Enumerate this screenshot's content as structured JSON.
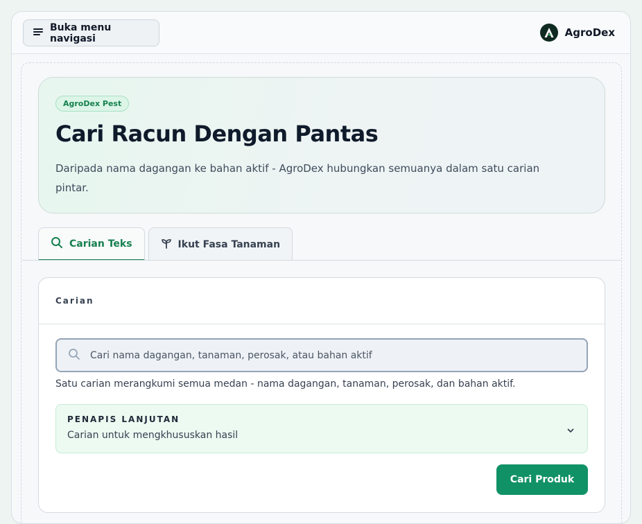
{
  "topbar": {
    "nav_button_label": "Buka menu navigasi",
    "brand_name": "AgroDex"
  },
  "hero": {
    "badge": "AgroDex Pest",
    "title": "Cari Racun Dengan Pantas",
    "description": "Daripada nama dagangan ke bahan aktif - AgroDex hubungkan semuanya dalam satu carian pintar."
  },
  "tabs": [
    {
      "label": "Carian Teks",
      "icon": "search-icon",
      "active": true
    },
    {
      "label": "Ikut Fasa Tanaman",
      "icon": "sprout-icon",
      "active": false
    }
  ],
  "search_card": {
    "heading": "Carian",
    "input_placeholder": "Cari nama dagangan, tanaman, perosak, atau bahan aktif",
    "input_value": "",
    "helper_text": "Satu carian merangkumi semua medan - nama dagangan, tanaman, perosak, dan bahan aktif.",
    "filter_title": "PENAPIS LANJUTAN",
    "filter_subtitle": "Carian untuk mengkhususkan hasil",
    "submit_label": "Cari Produk"
  },
  "colors": {
    "accent": "#119166",
    "accent_text": "#16804f",
    "brand_logo_bg": "#0f2a20"
  }
}
